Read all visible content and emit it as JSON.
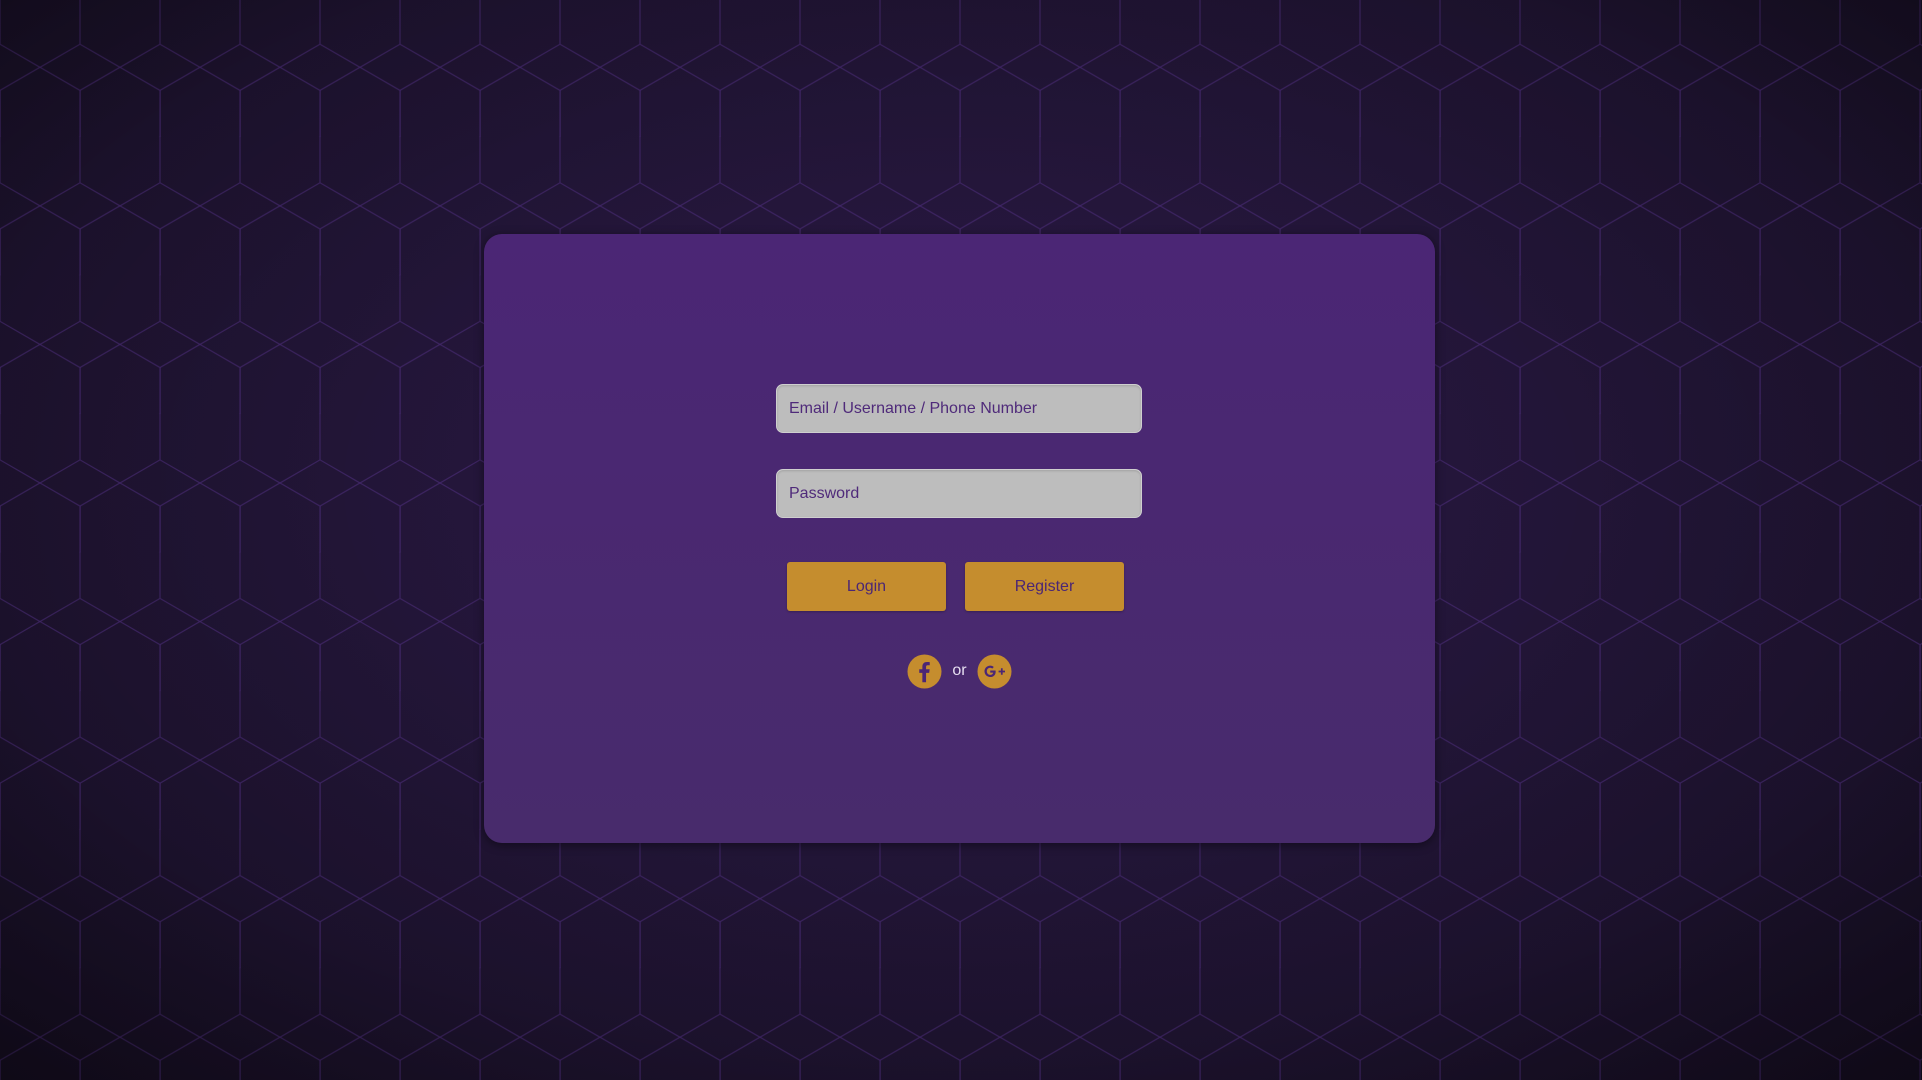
{
  "login_form": {
    "email_placeholder": "Email / Username / Phone Number",
    "password_placeholder": "Password",
    "login_label": "Login",
    "register_label": "Register"
  },
  "social": {
    "separator": "or",
    "providers": [
      "facebook-icon",
      "google-plus-icon"
    ]
  },
  "colors": {
    "background": "#25173c",
    "card": "#4b2675",
    "accent": "#c58d2e",
    "input": "#bdbdbd",
    "hex_lines": "#4a2c78"
  }
}
